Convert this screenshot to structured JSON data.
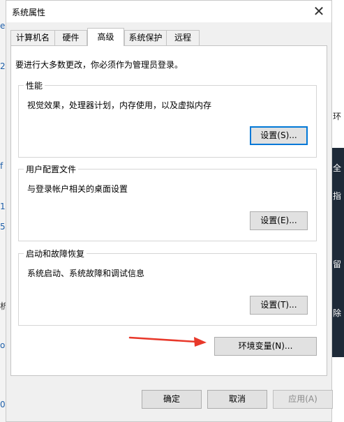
{
  "window": {
    "title": "系统属性",
    "close_glyph": "✕"
  },
  "tabs": [
    {
      "label": "计算机名",
      "active": false
    },
    {
      "label": "硬件",
      "active": false
    },
    {
      "label": "高级",
      "active": true
    },
    {
      "label": "系统保护",
      "active": false
    },
    {
      "label": "远程",
      "active": false
    }
  ],
  "notice": "要进行大多数更改，你必须作为管理员登录。",
  "groups": {
    "performance": {
      "legend": "性能",
      "description": "视觉效果，处理器计划，内存使用，以及虚拟内存",
      "button": "设置(S)..."
    },
    "user_profiles": {
      "legend": "用户配置文件",
      "description": "与登录帐户相关的桌面设置",
      "button": "设置(E)..."
    },
    "startup_recovery": {
      "legend": "启动和故障恢复",
      "description": "系统启动、系统故障和调试信息",
      "button": "设置(T)..."
    }
  },
  "env_button": "环境变量(N)...",
  "footer": {
    "ok": "确定",
    "cancel": "取消",
    "apply": "应用(A)"
  },
  "accent_color": "#0078d7",
  "arrow_color": "#e8382a",
  "background": {
    "left_fragments": [
      "e",
      "2",
      "f",
      "1",
      "5",
      "析",
      "o",
      "0"
    ],
    "right_fragments": [
      "环",
      "全",
      "指",
      "留",
      "除"
    ]
  }
}
